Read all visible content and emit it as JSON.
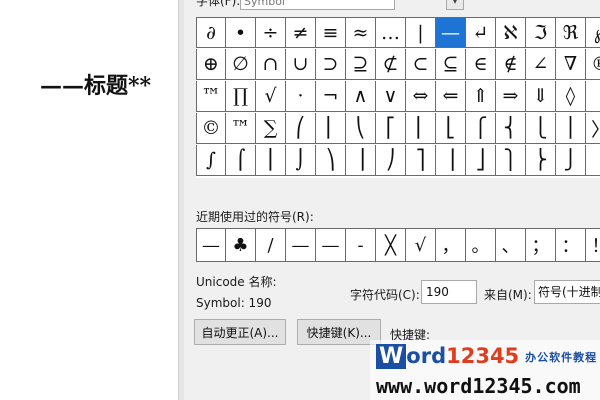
{
  "document": {
    "heading": "——标题**"
  },
  "dialog": {
    "font_label": "字体(F):",
    "font_value": "Symbol",
    "dropdown_glyph": "▾",
    "symbol_grid": [
      [
        "∂",
        "•",
        "÷",
        "≠",
        "≡",
        "≈",
        "…",
        "|",
        "—",
        "↵",
        "ℵ",
        "ℑ",
        "ℜ",
        "℘"
      ],
      [
        "⊕",
        "∅",
        "∩",
        "∪",
        "⊃",
        "⊇",
        "⊄",
        "⊂",
        "⊆",
        "∈",
        "∉",
        "∠",
        "∇",
        "®"
      ],
      [
        "™",
        "∏",
        "√",
        "·",
        "¬",
        "∧",
        "∨",
        "⇔",
        "⇐",
        "⇑",
        "⇒",
        "⇓",
        "◊",
        "〈"
      ],
      [
        "©",
        "™",
        "∑",
        "⎛",
        "⎜",
        "⎝",
        "⎡",
        "⎢",
        "⎣",
        "⎧",
        "⎨",
        "⎩",
        "⎪",
        "〉"
      ],
      [
        "∫",
        "⌠",
        "⎮",
        "⌡",
        "⎞",
        "⎟",
        "⎠",
        "⎤",
        "⎥",
        "⎦",
        "⎫",
        "⎬",
        "⎭",
        ""
      ]
    ],
    "selected_symbol": "—",
    "recent_label": "近期使用过的符号(R):",
    "recent_symbols": [
      "—",
      "♣",
      "/",
      "—",
      "—",
      "-",
      "╳",
      "√",
      "，",
      "。",
      "、",
      "；",
      "：",
      "！"
    ],
    "unicode_name_label": "Unicode 名称:",
    "symbol_code_text": "Symbol: 190",
    "char_code_label": "字符代码(C):",
    "char_code_value": "190",
    "from_label": "来自(M):",
    "from_value": "符号(十进制)",
    "autocorrect_button": "自动更正(A)...",
    "shortcut_key_button": "快捷键(K)...",
    "shortcut_label": "快捷键:"
  },
  "watermark": {
    "logo_w": "W",
    "logo_ord": "ord",
    "logo_num": "12345",
    "tagline": "办公软件教程",
    "url": "www.word12345.com"
  },
  "colors": {
    "selection": "#1e74d4",
    "dialog_bg": "#f0f0f0",
    "watermark_blue": "#1b4fa3",
    "watermark_red": "#e03c1e"
  }
}
